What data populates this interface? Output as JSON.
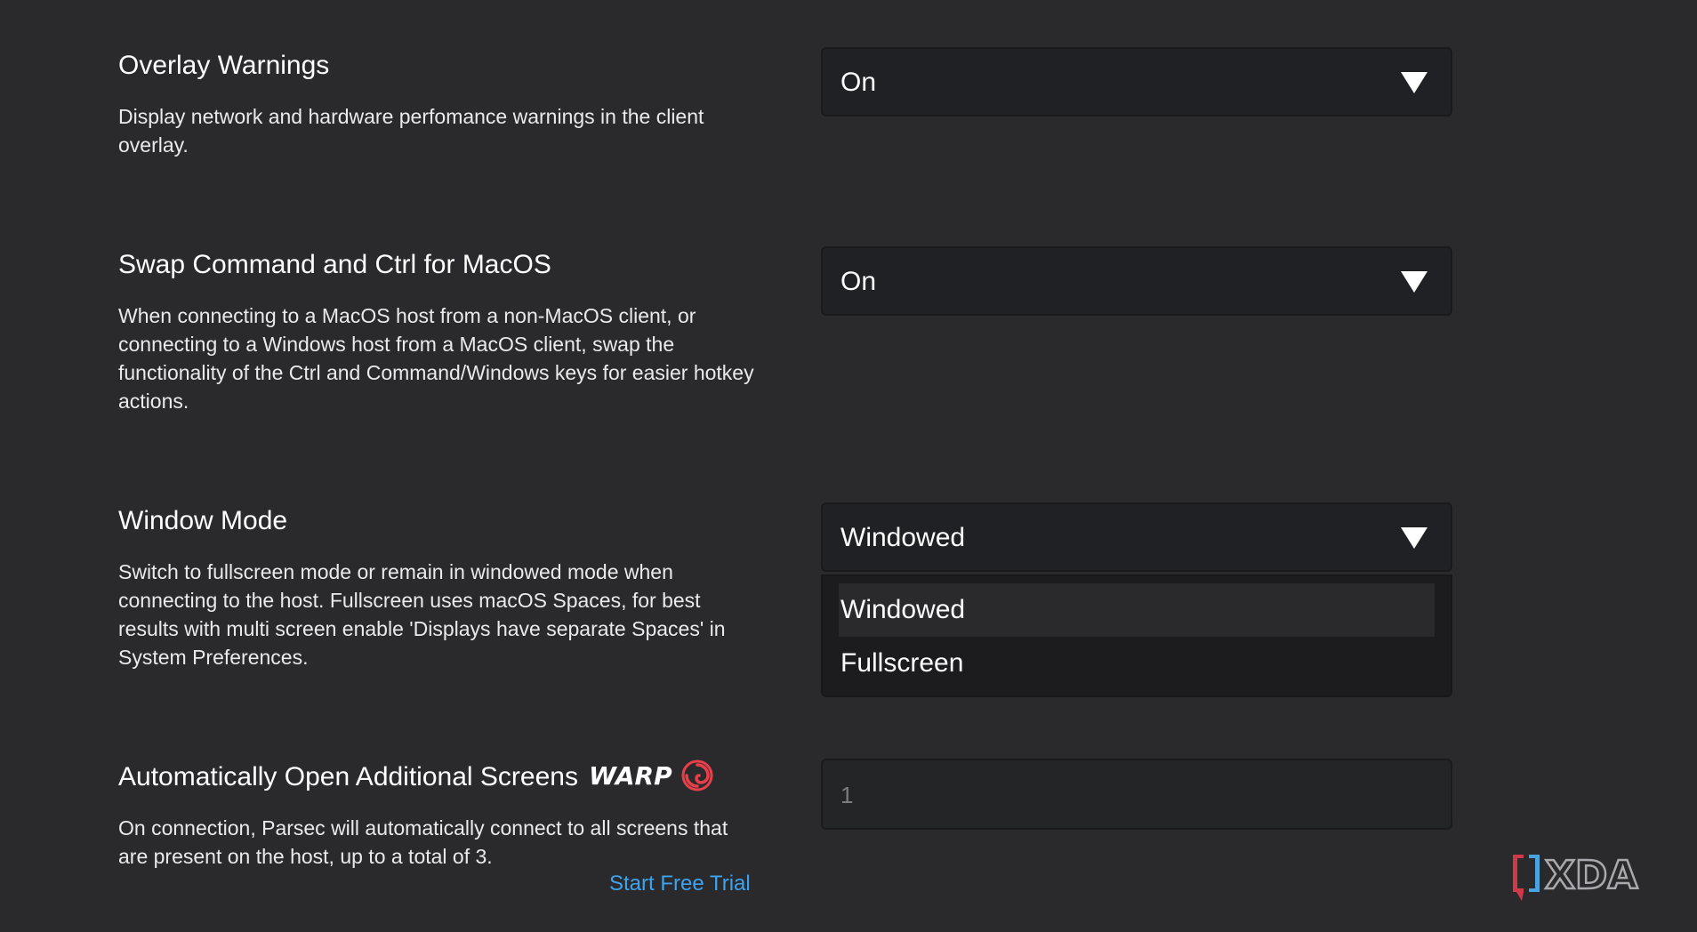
{
  "settings": [
    {
      "title": "Overlay Warnings",
      "description": "Display network and hardware perfomance warnings in the client overlay.",
      "value": "On"
    },
    {
      "title": "Swap Command and Ctrl for MacOS",
      "description": "When connecting to a MacOS host from a non-MacOS client, or connecting to a Windows host from a MacOS client, swap the functionality of the Ctrl and Command/Windows keys for easier hotkey actions.",
      "value": "On"
    },
    {
      "title": "Window Mode",
      "description": "Switch to fullscreen mode or remain in windowed mode when connecting to the host. Fullscreen uses macOS Spaces, for best results with multi screen enable 'Displays have separate Spaces' in System Preferences.",
      "value": "Windowed",
      "options": [
        "Windowed",
        "Fullscreen"
      ]
    },
    {
      "title": "Automatically Open Additional Screens",
      "badge": "WARP",
      "description": "On connection, Parsec will automatically connect to all screens that are present on the host, up to a total of 3.",
      "value": "1",
      "link": "Start Free Trial"
    }
  ],
  "watermark": "XDA",
  "colors": {
    "background": "#2a2a2d",
    "control": "#202124",
    "link": "#3ea3ec",
    "warp_icon": "#e8404a"
  }
}
